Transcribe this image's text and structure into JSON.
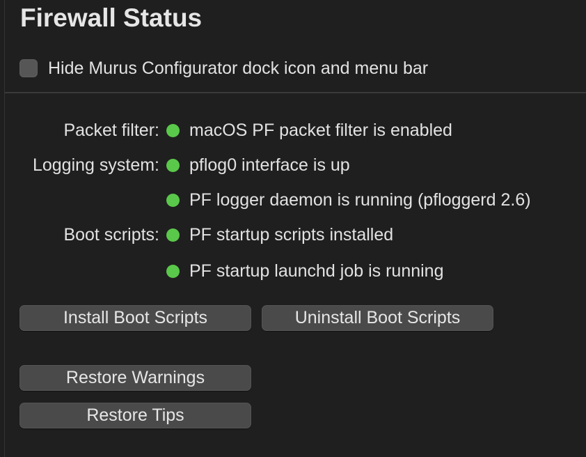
{
  "header": {
    "title": "Firewall Status"
  },
  "options": {
    "hide_dock_label": "Hide Murus Configurator dock icon and menu bar",
    "hide_dock_checked": false
  },
  "status": {
    "packet_filter_label": "Packet filter:",
    "packet_filter_text": "macOS PF packet filter is enabled",
    "logging_label": "Logging system:",
    "pflog_text": "pflog0 interface is up",
    "logger_daemon_text": "PF logger daemon is running (pfloggerd 2.6)",
    "boot_label": "Boot scripts:",
    "startup_scripts_text": "PF startup scripts installed",
    "launchd_text": "PF startup launchd job is running",
    "indicator_color": "#5ac84a"
  },
  "buttons": {
    "install_boot": "Install Boot Scripts",
    "uninstall_boot": "Uninstall Boot Scripts",
    "restore_warnings": "Restore Warnings",
    "restore_tips": "Restore Tips"
  }
}
